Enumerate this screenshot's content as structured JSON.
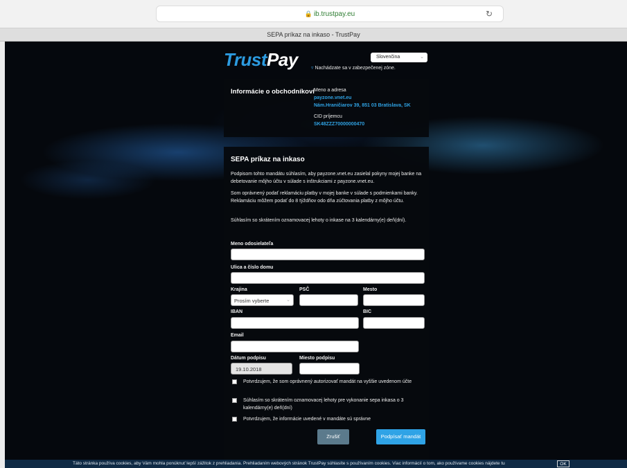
{
  "browser": {
    "url": "ib.trustpay.eu",
    "tab_title": "SEPA príkaz na inkaso - TrustPay"
  },
  "header": {
    "logo_part1": "Trust",
    "logo_part2": "Pay",
    "language": "Slovenčina",
    "secure_note": "Nachádzate sa v zabezpečenej zóne."
  },
  "merchant": {
    "title": "Informácie o obchodníkovi",
    "name_label": "Meno a adresa",
    "name": "payzone.vnet.eu",
    "address": "Nám.Hraničiarov 39, 851 03 Bratislava, SK",
    "cid_label": "CID príjemcu",
    "cid": "SK48ZZZ70000000470"
  },
  "mandate": {
    "title": "SEPA príkaz na inkaso",
    "para1": "Podpisom tohto mandátu súhlasím, aby payzone.vnet.eu zasielal pokyny mojej banke na debetovanie môjho účtu v súlade s inštrukciami z payzone.vnet.eu.",
    "para2": "Som oprávnený podať reklamáciu platby v mojej banke v súlade s podmienkami banky. Reklamáciu môžem podať do 8 týždňov odo dňa zúčtovania platby z môjho účtu.",
    "para3": "Súhlasím so skrátením oznamovacej lehoty o inkase na 3 kalendárny(e) deň(dní).",
    "fields": {
      "sender_name": "Meno odosielateľa",
      "street": "Ulica a číslo domu",
      "country": "Krajina",
      "country_value": "Prosím vyberte",
      "zip": "PSČ",
      "city": "Mesto",
      "iban": "IBAN",
      "bic": "BIC",
      "email": "Email",
      "sign_date": "Dátum podpisu",
      "sign_date_value": "19.10.2018",
      "sign_place": "Miesto podpisu"
    },
    "checks": [
      "Potvrdzujem, že som oprávnený autorizovať mandát na vyššie uvedenom účte",
      "Súhlasím so skrátením oznamovacej lehoty pre vykonanie sepa inkasa o 3 kalendárny(e) deň(dní)",
      "Potvrdzujem, že informácie uvedené v mandáte sú správne"
    ],
    "cancel_label": "Zrušiť",
    "sign_label": "Podpísať mandát"
  },
  "cookie": {
    "text": "Táto stránka používa cookies, aby Vám mohla ponúknuť lepší zážitok z prehliadania. Prehliadaním webových stránok TrustPay súhlasíte s používaním cookies. Viac informácií o tom, ako používame cookies nájdete tu",
    "ok_label": "OK"
  }
}
